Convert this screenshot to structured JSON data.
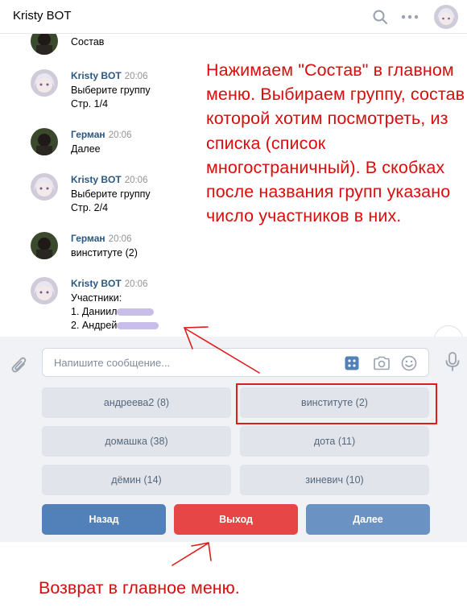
{
  "header": {
    "title": "Kristy BOT"
  },
  "messages": [
    {
      "author": "",
      "time": "",
      "lines": [
        "Состав"
      ],
      "kind": "user"
    },
    {
      "author": "Kristy BOT",
      "time": "20:06",
      "lines": [
        "Выберите группу",
        "Стр. 1/4"
      ],
      "kind": "bot"
    },
    {
      "author": "Герман",
      "time": "20:06",
      "lines": [
        "Далее"
      ],
      "kind": "user"
    },
    {
      "author": "Kristy BOT",
      "time": "20:06",
      "lines": [
        "Выберите группу",
        "Стр. 2/4"
      ],
      "kind": "bot"
    },
    {
      "author": "Герман",
      "time": "20:06",
      "lines": [
        "винституте (2)"
      ],
      "kind": "user"
    },
    {
      "author": "Kristy BOT",
      "time": "20:06",
      "lines": [
        "Участники:",
        "1. Даниил",
        "2. Андрей"
      ],
      "kind": "bot"
    }
  ],
  "annotation_main": "Нажимаем \"Состав\" в главном меню. Выбираем группу, состав которой хотим посмотреть, из списка (список многостраничный). В скобках после названия групп указано число участников в них.",
  "annotation_bottom": "Возврат в главное меню.",
  "composer": {
    "placeholder": "Напишите сообщение..."
  },
  "keyboard": {
    "row1": [
      "андреева2 (8)",
      "винституте (2)"
    ],
    "row2": [
      "домашка (38)",
      "дота (11)"
    ],
    "row3": [
      "дёмин (14)",
      "зиневич (10)"
    ],
    "nav": {
      "back": "Назад",
      "exit": "Выход",
      "next": "Далее"
    }
  },
  "colors": {
    "annotation": "#d80d0d",
    "link": "#2a5885",
    "btn_blue": "#5181b8",
    "btn_red": "#e64646"
  }
}
